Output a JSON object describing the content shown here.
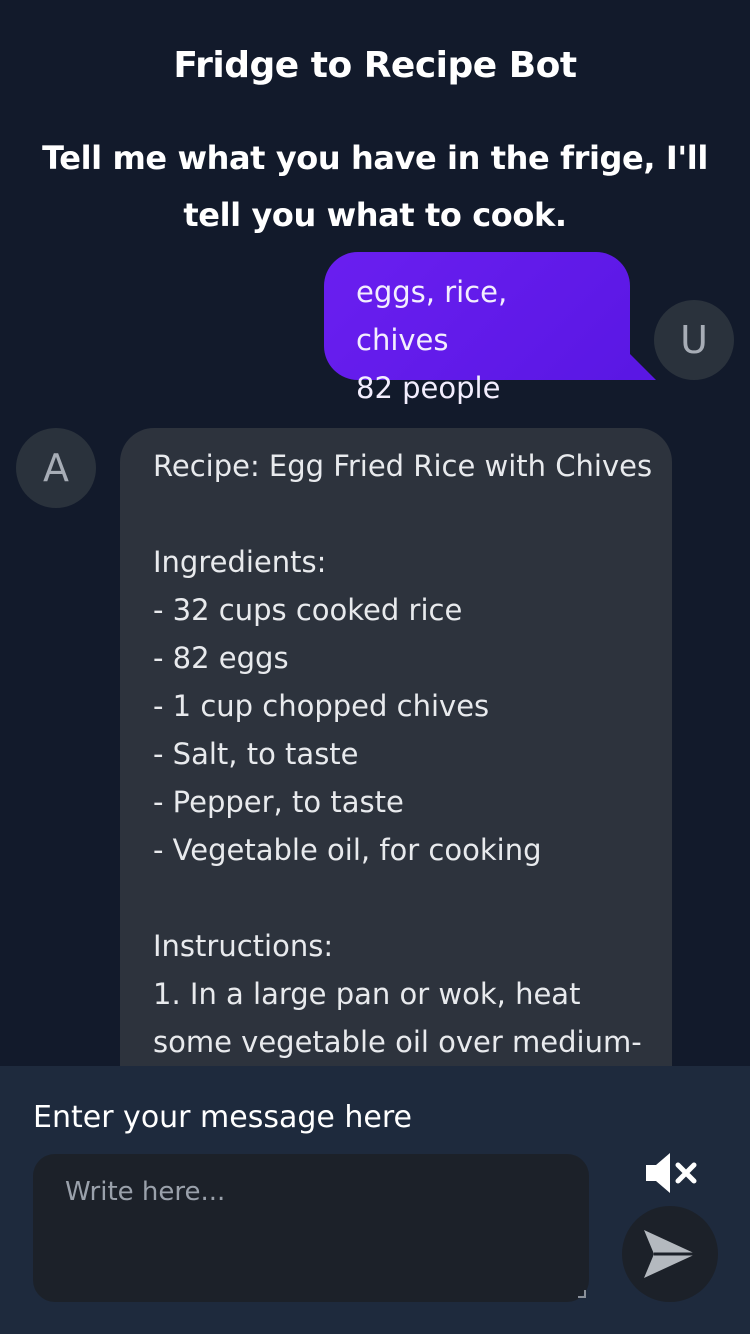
{
  "header": {
    "title": "Fridge to Recipe Bot",
    "subtitle": "Tell me what you have in the frige, I'll tell you what to cook."
  },
  "conversation": {
    "user_message": {
      "avatar_letter": "U",
      "lines": [
        "eggs, rice, chives",
        "82 people"
      ]
    },
    "bot_message": {
      "avatar_letter": "A",
      "lines": [
        "Recipe: Egg Fried Rice with Chives",
        "",
        "Ingredients:",
        "- 32 cups cooked rice",
        "- 82 eggs",
        "- 1 cup chopped chives",
        "- Salt, to taste",
        "- Pepper, to taste",
        "- Vegetable oil, for cooking",
        "",
        "Instructions:",
        "1. In a large pan or wok, heat",
        "some vegetable oil over medium-"
      ]
    }
  },
  "composer": {
    "label": "Enter your message here",
    "placeholder": "Write here...",
    "value": "",
    "mute_icon": "speaker-muted-icon",
    "send_icon": "send-arrow-icon"
  },
  "colors": {
    "background": "#121a2b",
    "user_bubble": "#5a17e4",
    "bot_bubble": "#2d333d",
    "composer_bg": "#1e2a3d",
    "input_bg": "#1c2129"
  }
}
